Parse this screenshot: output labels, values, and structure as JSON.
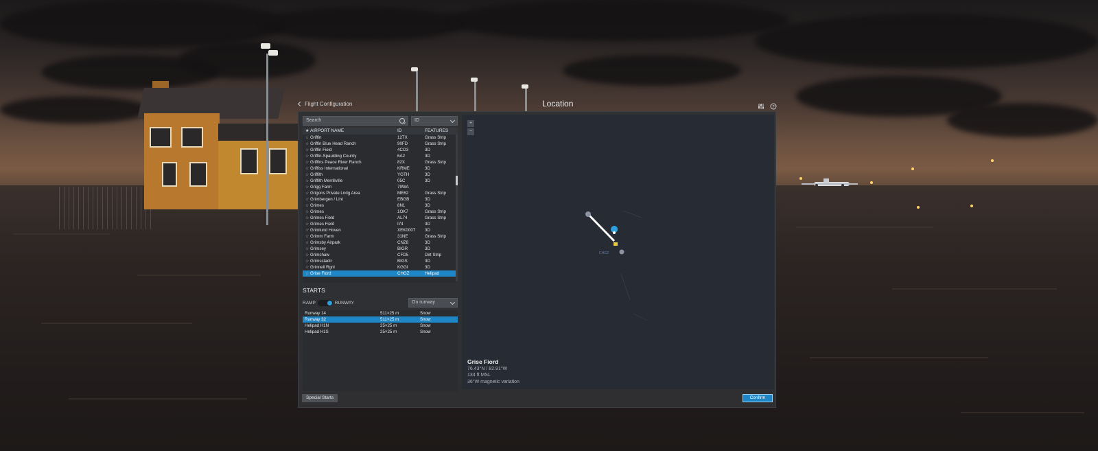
{
  "header": {
    "back_label": "Flight Configuration",
    "title": "Location"
  },
  "search": {
    "placeholder": "Search",
    "filter_selected": "ID"
  },
  "airport_table": {
    "columns": {
      "name": "AIRPORT NAME",
      "id": "ID",
      "features": "FEATURES"
    },
    "rows": [
      {
        "name": "Griffin",
        "id": "12TX",
        "features": "Grass Strip"
      },
      {
        "name": "Griffin Blue Head Ranch",
        "id": "90FD",
        "features": "Grass Strip"
      },
      {
        "name": "Griffin Field",
        "id": "4CO3",
        "features": "3D"
      },
      {
        "name": "Griffin-Spaulding County",
        "id": "6A2",
        "features": "3D"
      },
      {
        "name": "Griffins Peace River Ranch",
        "id": "82X",
        "features": "Grass Strip"
      },
      {
        "name": "Griffiss International",
        "id": "KRME",
        "features": "3D"
      },
      {
        "name": "Griffith",
        "id": "YGTH",
        "features": "3D"
      },
      {
        "name": "Griffith Merrillville",
        "id": "05C",
        "features": "3D"
      },
      {
        "name": "Grigg Farm",
        "id": "79WA",
        "features": ""
      },
      {
        "name": "Grigons Private Lndg Area",
        "id": "ME62",
        "features": "Grass Strip"
      },
      {
        "name": "Grimbergen / Lint",
        "id": "EBGB",
        "features": "3D"
      },
      {
        "name": "Grimes",
        "id": "8N1",
        "features": "3D"
      },
      {
        "name": "Grimes",
        "id": "1OK7",
        "features": "Grass Strip"
      },
      {
        "name": "Grimes Field",
        "id": "AL74",
        "features": "Grass Strip"
      },
      {
        "name": "Grimes Field",
        "id": "I74",
        "features": "3D"
      },
      {
        "name": "Grimlund Hoven",
        "id": "XEK000T",
        "features": "3D"
      },
      {
        "name": "Grimm Farm",
        "id": "31NE",
        "features": "Grass Strip"
      },
      {
        "name": "Grimsby Airpark",
        "id": "CNZ8",
        "features": "3D"
      },
      {
        "name": "Grimsey",
        "id": "BIGR",
        "features": "3D"
      },
      {
        "name": "Grimshaw",
        "id": "CFD5",
        "features": "Dirt Strip"
      },
      {
        "name": "Grimsstadir",
        "id": "BIGS",
        "features": "3D"
      },
      {
        "name": "Grinnell Rgnl",
        "id": "KGGI",
        "features": "3D"
      },
      {
        "name": "Grise Fiord",
        "id": "CHGZ",
        "features": "Helipad"
      }
    ]
  },
  "starts": {
    "title": "STARTS",
    "ramp_label": "RAMP",
    "runway_label": "RUNWAY",
    "position_selected": "On runway",
    "rows": [
      {
        "name": "Runway 14",
        "dims": "511×25 m",
        "surface": "Snow"
      },
      {
        "name": "Runway 32",
        "dims": "511×25 m",
        "surface": "Snow"
      },
      {
        "name": "Helipad H1N",
        "dims": "25×25 m",
        "surface": "Snow"
      },
      {
        "name": "Helipad H1S",
        "dims": "25×25 m",
        "surface": "Snow"
      }
    ]
  },
  "map": {
    "zoom_in": "+",
    "zoom_out": "−",
    "airport_name": "Grise Fiord",
    "coords": "76.43°N / 82.91°W",
    "elevation": "134 ft MSL",
    "variation": "36°W magnetic variation"
  },
  "footer": {
    "special_starts": "Special Starts",
    "confirm": "Confirm"
  },
  "colors": {
    "accent": "#1e86c4",
    "dialog_bg": "#2f3134",
    "map_bg": "#272b33"
  }
}
